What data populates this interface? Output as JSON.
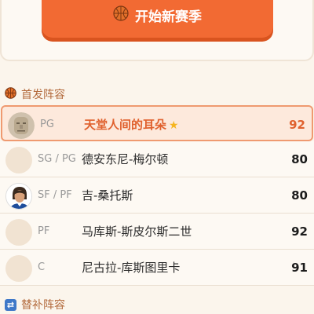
{
  "start_button": {
    "label": "开始新赛季",
    "icon": "basketball-icon"
  },
  "starting_section": {
    "title": "首发阵容",
    "icon": "basketball-icon"
  },
  "bench_section": {
    "title": "替补阵容",
    "icon": "swap-icon"
  },
  "colors": {
    "accent": "#f26a33",
    "highlight_bg": "#fde9dc",
    "star": "#f5b51f"
  },
  "starters": [
    {
      "position": "PG",
      "name": "天堂人间的耳朵",
      "rating": "92",
      "selected": true,
      "star": "★",
      "avatar": "stone-face-avatar"
    },
    {
      "position": "SG / PG",
      "name": "德安东尼-梅尔顿",
      "rating": "80",
      "selected": false,
      "avatar": "placeholder-avatar"
    },
    {
      "position": "SF / PF",
      "name": "吉-桑托斯",
      "rating": "80",
      "selected": false,
      "avatar": "player-photo-avatar"
    },
    {
      "position": "PF",
      "name": "马库斯-斯皮尔斯二世",
      "rating": "92",
      "selected": false,
      "avatar": "placeholder-avatar"
    },
    {
      "position": "C",
      "name": "尼古拉-库斯图里卡",
      "rating": "91",
      "selected": false,
      "avatar": "placeholder-avatar"
    }
  ]
}
